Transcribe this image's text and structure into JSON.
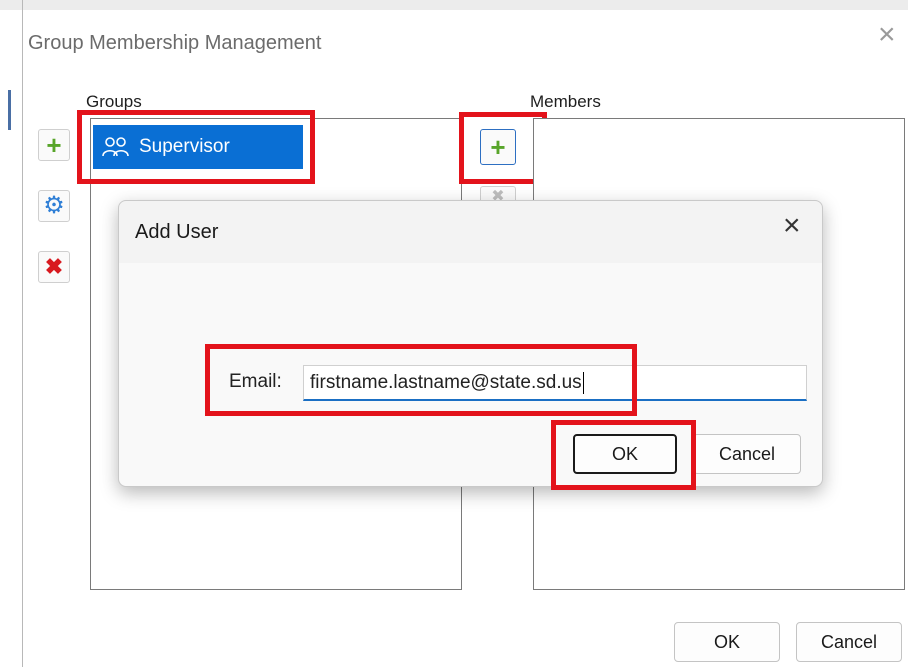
{
  "parent": {
    "title": "Group Membership Management",
    "groups_label": "Groups",
    "members_label": "Members",
    "groups": [
      {
        "name": "Supervisor",
        "selected": true
      }
    ],
    "ok_label": "OK",
    "cancel_label": "Cancel"
  },
  "dialog": {
    "title": "Add User",
    "email_label": "Email:",
    "email_value": "firstname.lastname@state.sd.us",
    "ok_label": "OK",
    "cancel_label": "Cancel"
  },
  "colors": {
    "selection": "#0a6fd4",
    "highlight": "#e3131b",
    "add_icon": "#58a52a",
    "remove_icon": "#d8191f",
    "settings_icon": "#2f7fd6"
  },
  "icons": {
    "group": "group-icon",
    "add": "plus-icon",
    "settings": "gear-icon",
    "delete": "x-icon",
    "close": "close-icon"
  }
}
